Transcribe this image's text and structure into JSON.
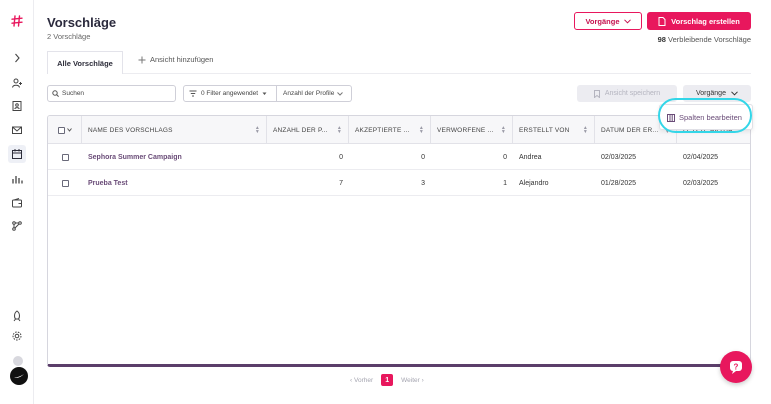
{
  "colors": {
    "brand": "#e8175d",
    "accent_text": "#6a4c78",
    "highlight": "#33d6e8"
  },
  "sidebar": {
    "icons": [
      "logo-hash-icon",
      "chevron-right-icon",
      "user-plus-icon",
      "contact-card-icon",
      "mail-icon",
      "calendar-icon",
      "bar-chart-icon",
      "wallet-icon",
      "network-icon",
      "rocket-icon",
      "gear-icon"
    ]
  },
  "header": {
    "title": "Vorschläge",
    "subtitle": "2 Vorschläge",
    "ops_label": "Vorgänge",
    "create_label": "Vorschlag erstellen",
    "remaining_count": "98",
    "remaining_label": "Verbleibende Vorschläge"
  },
  "tabs": {
    "active": "Alle Vorschläge",
    "add": "Ansicht hinzufügen"
  },
  "toolbar": {
    "search_placeholder": "Suchen",
    "filter_label": "0 Filter angewendet",
    "profiles_label": "Anzahl der Profile",
    "save_view_label": "Ansicht speichern",
    "ops_label": "Vorgänge"
  },
  "table": {
    "columns": [
      "NAME DES VORSCHLAGS",
      "ANZAHL DER P...",
      "AKZEPTIERTE ...",
      "VERWORFENE ...",
      "ERSTELLT VON",
      "DATUM DER ER...",
      "LETZTE AKTUA..."
    ],
    "rows": [
      {
        "name": "Sephora Summer Campaign",
        "profiles": "0",
        "accepted": "0",
        "rejected": "0",
        "created_by": "Andrea",
        "created_on": "02/03/2025",
        "updated_on": "02/04/2025"
      },
      {
        "name": "Prueba Test",
        "profiles": "7",
        "accepted": "3",
        "rejected": "1",
        "created_by": "Alejandro",
        "created_on": "01/28/2025",
        "updated_on": "02/03/2025"
      }
    ]
  },
  "menu": {
    "edit_columns": "Spalten bearbeiten"
  },
  "pagination": {
    "prev": "Vorher",
    "current": "1",
    "next": "Weiter"
  }
}
